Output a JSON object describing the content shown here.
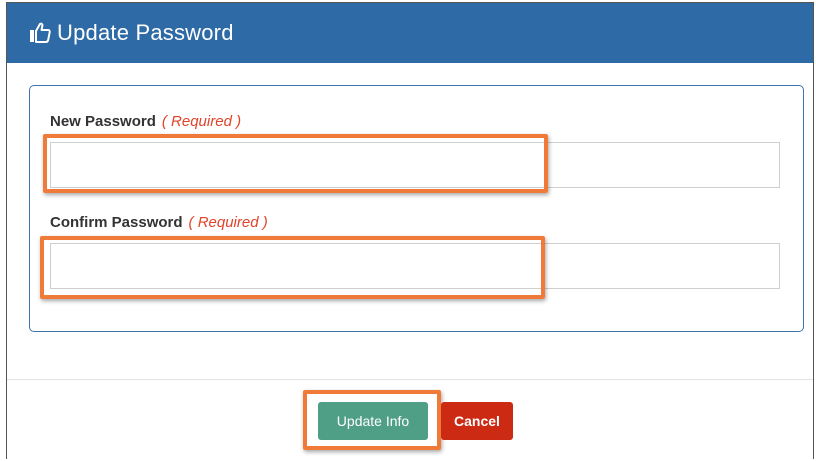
{
  "header": {
    "title": "Update Password",
    "icon": "thumbs-up-icon",
    "background_color": "#2e6aa6"
  },
  "form": {
    "new_password": {
      "label": "New Password",
      "required_text": "( Required )",
      "value": ""
    },
    "confirm_password": {
      "label": "Confirm Password",
      "required_text": "( Required )",
      "value": ""
    }
  },
  "actions": {
    "update_label": "Update Info",
    "cancel_label": "Cancel",
    "update_color": "#4f9e86",
    "cancel_color": "#cc2a12"
  },
  "highlight_color": "#f07a3a",
  "required_color": "#e0442a"
}
